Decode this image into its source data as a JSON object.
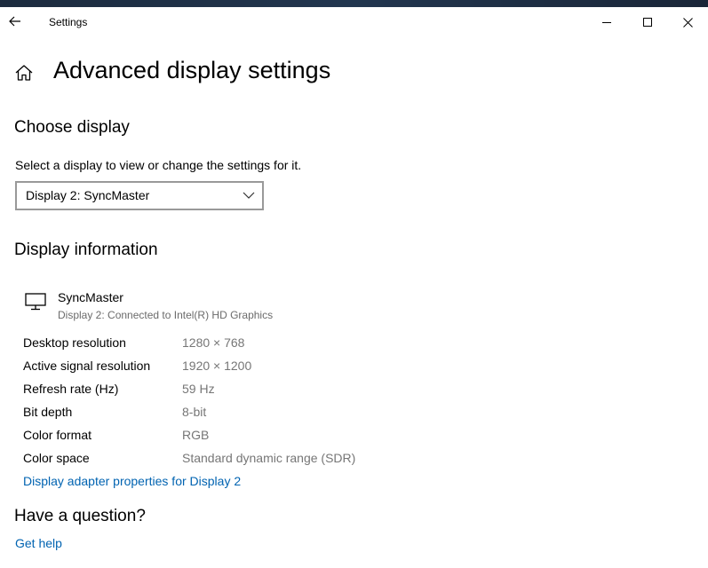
{
  "window": {
    "title": "Settings",
    "back_icon": "back-arrow-icon",
    "controls": {
      "minimize_icon": "minimize-icon",
      "maximize_icon": "maximize-icon",
      "close_icon": "close-icon"
    }
  },
  "page": {
    "home_icon": "home-icon",
    "title": "Advanced display settings"
  },
  "choose_display": {
    "heading": "Choose display",
    "description": "Select a display to view or change the settings for it.",
    "selected_value": "Display 2: SyncMaster"
  },
  "display_info": {
    "heading": "Display information",
    "monitor_icon": "monitor-icon",
    "monitor_name": "SyncMaster",
    "monitor_subtitle": "Display 2: Connected to Intel(R) HD Graphics",
    "rows": [
      {
        "label": "Desktop resolution",
        "value": "1280 × 768"
      },
      {
        "label": "Active signal resolution",
        "value": "1920 × 1200"
      },
      {
        "label": "Refresh rate (Hz)",
        "value": "59 Hz"
      },
      {
        "label": "Bit depth",
        "value": "8-bit"
      },
      {
        "label": "Color format",
        "value": "RGB"
      },
      {
        "label": "Color space",
        "value": "Standard dynamic range (SDR)"
      }
    ],
    "adapter_link": "Display adapter properties for Display 2"
  },
  "question": {
    "heading": "Have a question?",
    "help_link": "Get help"
  },
  "colors": {
    "accent_link": "#0063b1",
    "secondary_text": "#767676",
    "select_border": "#999999"
  }
}
